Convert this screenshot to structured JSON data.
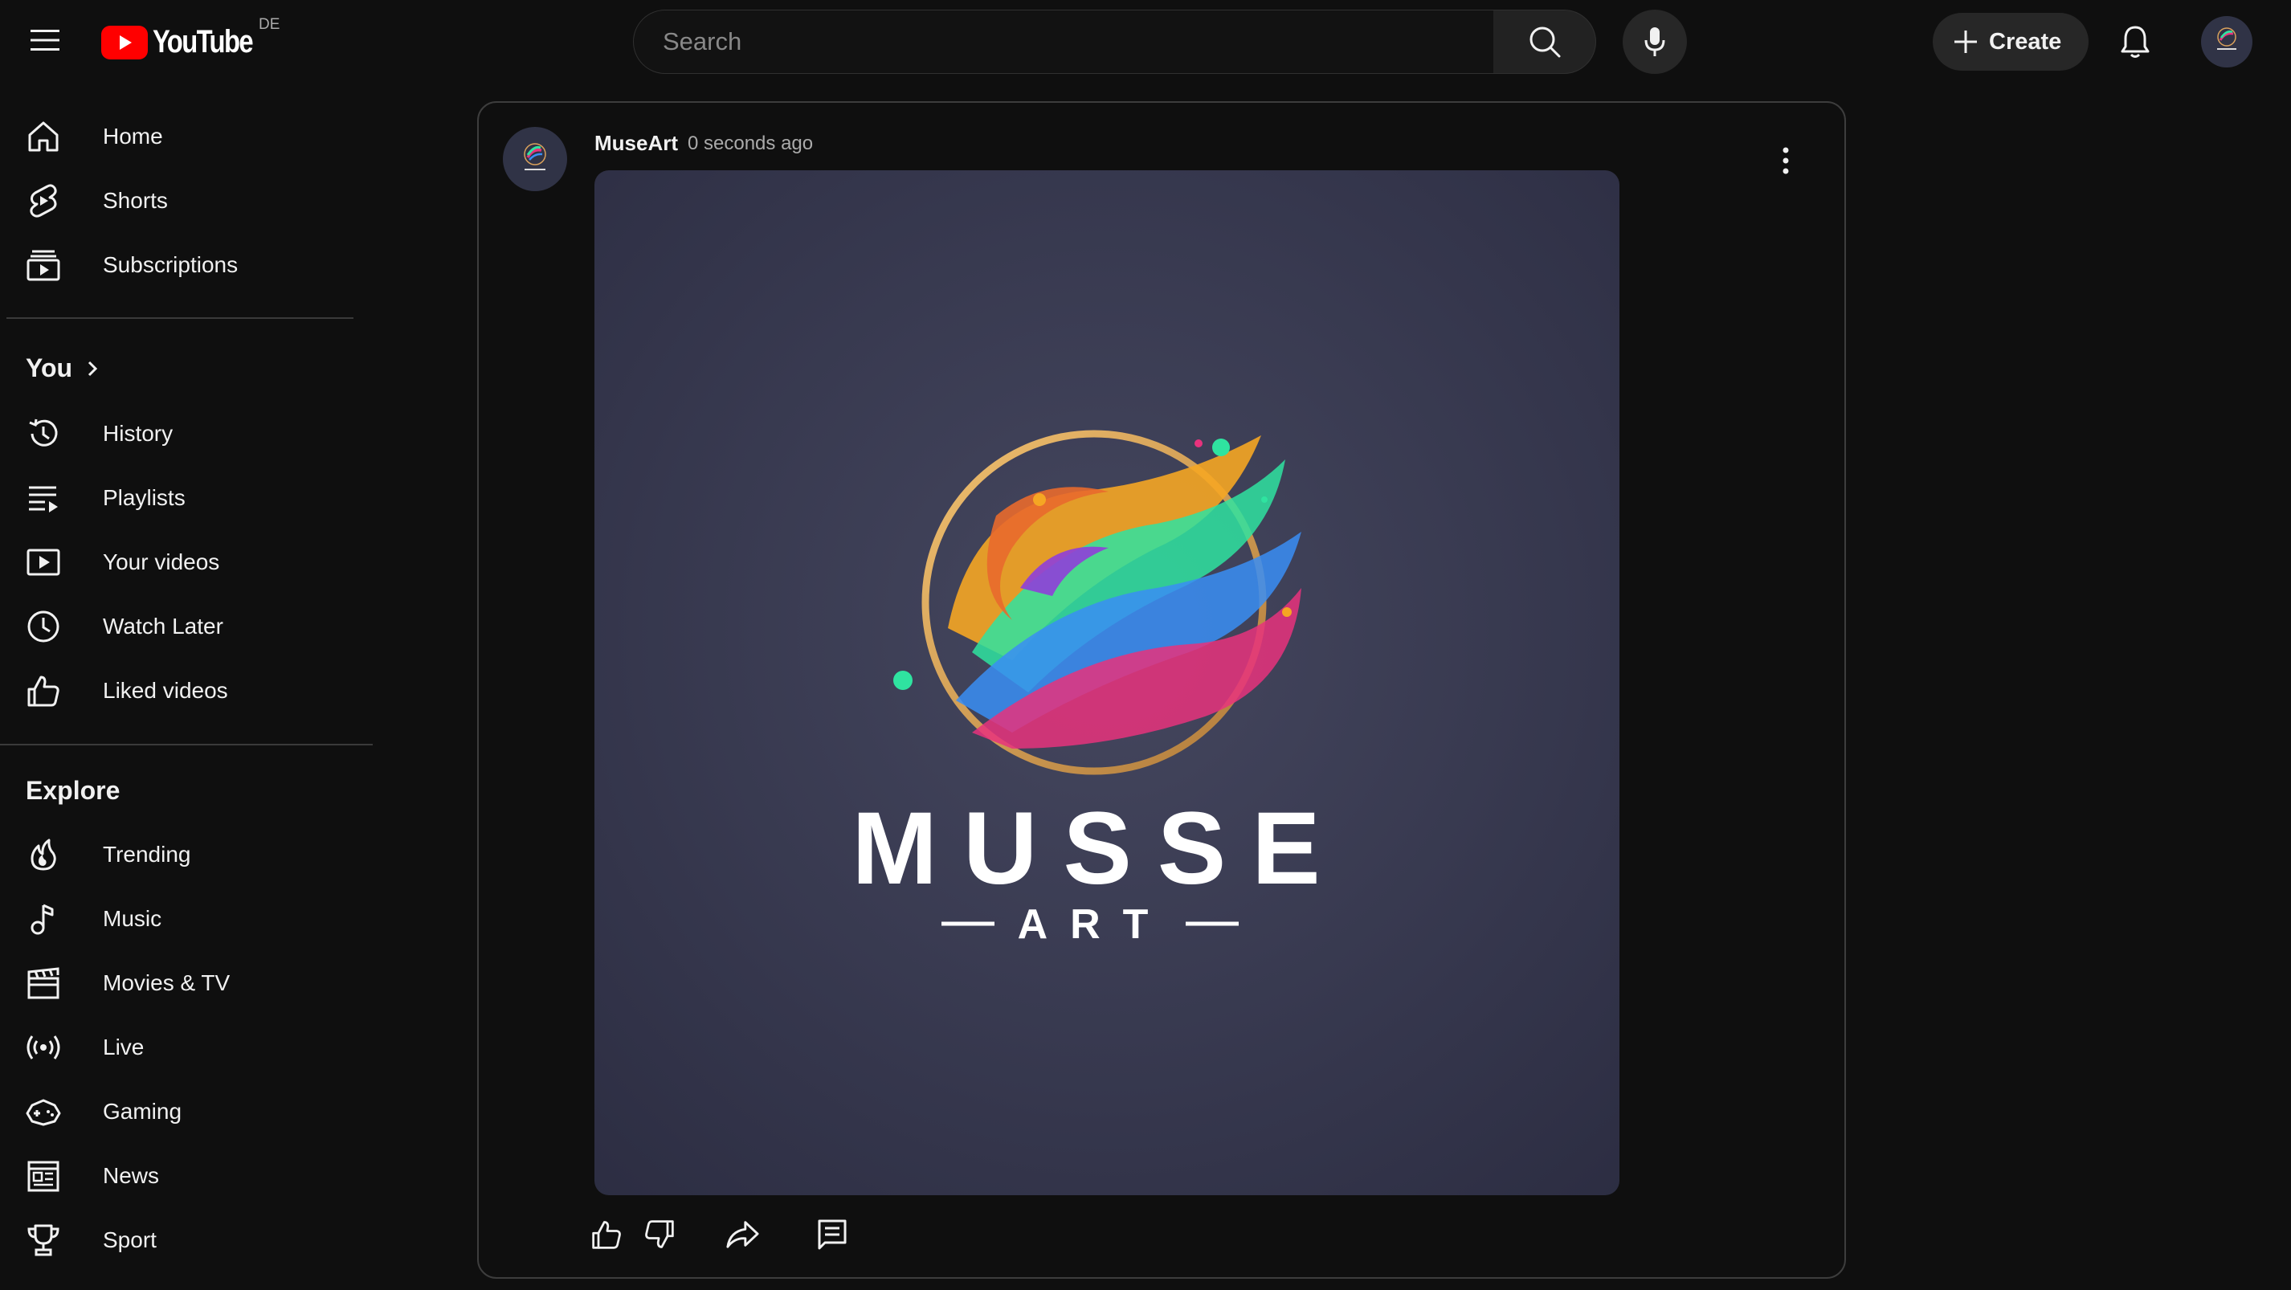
{
  "masthead": {
    "logo_text": "YouTube",
    "country_code": "DE",
    "search_placeholder": "Search",
    "create_label": "Create",
    "icons": [
      "menu-icon",
      "youtube-logo-icon",
      "search-icon",
      "mic-icon",
      "plus-icon",
      "bell-icon",
      "avatar"
    ]
  },
  "sidebar": {
    "main_items": [
      {
        "label": "Home",
        "icon": "home-icon"
      },
      {
        "label": "Shorts",
        "icon": "shorts-icon"
      },
      {
        "label": "Subscriptions",
        "icon": "subscriptions-icon"
      }
    ],
    "you_title": "You",
    "you_items": [
      {
        "label": "History",
        "icon": "history-icon"
      },
      {
        "label": "Playlists",
        "icon": "playlists-icon"
      },
      {
        "label": "Your videos",
        "icon": "your-videos-icon"
      },
      {
        "label": "Watch Later",
        "icon": "clock-icon"
      },
      {
        "label": "Liked videos",
        "icon": "thumbs-up-icon"
      }
    ],
    "explore_title": "Explore",
    "explore_items": [
      {
        "label": "Trending",
        "icon": "trending-icon"
      },
      {
        "label": "Music",
        "icon": "music-icon"
      },
      {
        "label": "Movies & TV",
        "icon": "clapperboard-icon"
      },
      {
        "label": "Live",
        "icon": "live-icon"
      },
      {
        "label": "Gaming",
        "icon": "gaming-icon"
      },
      {
        "label": "News",
        "icon": "news-icon"
      },
      {
        "label": "Sport",
        "icon": "trophy-icon"
      }
    ]
  },
  "post": {
    "channel": "MuseArt",
    "time": "0 seconds ago",
    "image": {
      "title": "MUSSE",
      "subtitle": "ART",
      "background": "#3b3d57",
      "ring_color": "#d9a15c",
      "brush_colors": [
        "#f5a623",
        "#2fe3a0",
        "#3a8ef5",
        "#e8327d",
        "#8f3fd9"
      ]
    },
    "actions": [
      "thumbs-up-icon",
      "thumbs-down-icon",
      "share-icon",
      "comment-icon"
    ]
  },
  "colors": {
    "background": "#0f0f0f",
    "youtube_red": "#ff0000",
    "text": "#f1f1f1",
    "muted_text": "#aaaaaa"
  }
}
